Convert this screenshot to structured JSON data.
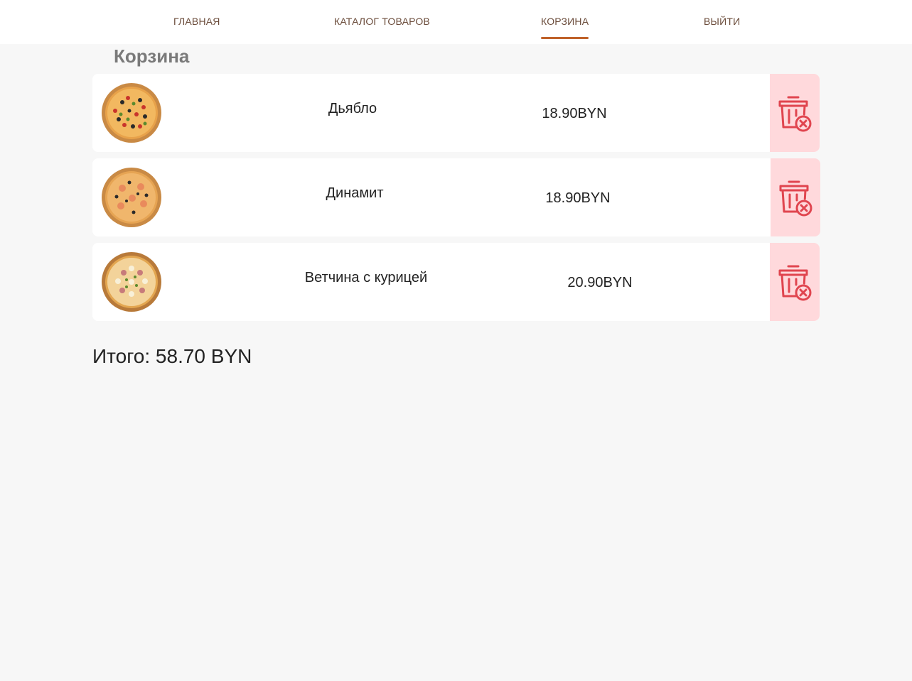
{
  "nav": {
    "items": [
      {
        "label": "ГЛАВНАЯ",
        "active": false
      },
      {
        "label": "КАТАЛОГ ТОВАРОВ",
        "active": false
      },
      {
        "label": "КОРЗИНА",
        "active": true
      },
      {
        "label": "ВЫЙТИ",
        "active": false
      }
    ],
    "active_color": "#c0622a"
  },
  "page": {
    "title": "Корзина"
  },
  "cart": {
    "items": [
      {
        "name": "Дьябло",
        "price": "18.90BYN",
        "image_icon": "pizza-icon"
      },
      {
        "name": "Динамит",
        "price": "18.90BYN",
        "image_icon": "pizza-icon"
      },
      {
        "name": "Ветчина с курицей",
        "price": "20.90BYN",
        "image_icon": "pizza-icon"
      }
    ],
    "delete_icon": "trash-remove-icon",
    "delete_color": "#e0454f",
    "delete_bg": "#ffd9dc"
  },
  "total": {
    "text": "Итого: 58.70 BYN"
  }
}
